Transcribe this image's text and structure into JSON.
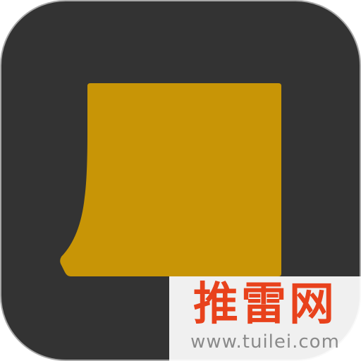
{
  "icon": {
    "name": "sticky-note-app-icon",
    "background_color": "#333333",
    "border_color": "#a8a8a8",
    "note_color": "#c89506"
  },
  "watermark": {
    "brand": "推雷网",
    "url": "www.tuilei.com",
    "brand_color": "#e8421c",
    "url_color": "#8a8a8a"
  }
}
